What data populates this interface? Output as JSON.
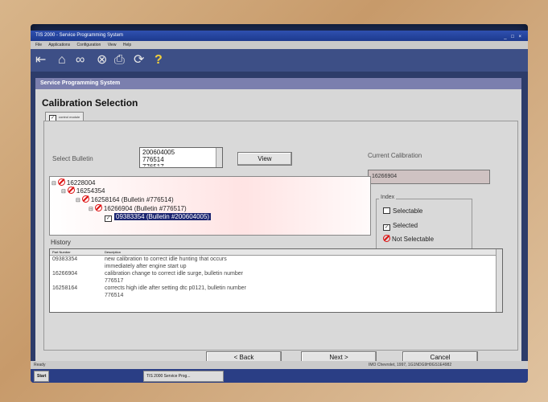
{
  "window": {
    "title": "TIS 2000 - Service Programming System",
    "controls": "_ □ ×"
  },
  "menu": [
    "File",
    "Applications",
    "Configuration",
    "View",
    "Help"
  ],
  "toolbar_icons": [
    "back-arrow-icon",
    "home-icon",
    "binoculars-icon",
    "stop-icon",
    "print-icon",
    "refresh-icon",
    "help-icon"
  ],
  "app": {
    "header": "Service Programming System",
    "title": "Calibration Selection",
    "tab": "control module"
  },
  "bulletin": {
    "label": "Select Bulletin",
    "options": [
      "200604005",
      "776514",
      "776517"
    ],
    "view_button": "View"
  },
  "current_calibration": {
    "label": "Current Calibration",
    "value": "16266904"
  },
  "tree": {
    "nodes": [
      {
        "text": "16228004",
        "level": 0,
        "icon": "not-selectable"
      },
      {
        "text": "16254354",
        "level": 1,
        "icon": "not-selectable"
      },
      {
        "text": "16258164   (Bulletin #776514)",
        "level": 2,
        "icon": "not-selectable"
      },
      {
        "text": "16266904   (Bulletin #776517)",
        "level": 3,
        "icon": "not-selectable"
      },
      {
        "text": "09383354   (Bulletin #200604005)",
        "level": 4,
        "icon": "selected"
      }
    ]
  },
  "legend": {
    "title": "Index",
    "selectable": "Selectable",
    "selected": "Selected",
    "not_selectable": "Not Selectable"
  },
  "history": {
    "label": "History",
    "columns": [
      "Part Number",
      "Description"
    ],
    "rows": [
      {
        "part": "09383354",
        "desc": "new calibration to correct idle hunting that occurs",
        "desc2": "immediately after engine start up"
      },
      {
        "part": "16266904",
        "desc": "calibration change to correct idle surge, bulletin number",
        "desc2": "776517"
      },
      {
        "part": "16258164",
        "desc": "corrects high idle after setting dtc p0121, bulletin number",
        "desc2": "776514"
      }
    ]
  },
  "buttons": {
    "back": "< Back",
    "next": "Next >",
    "cancel": "Cancel"
  },
  "statusbar": {
    "left": "Ready",
    "right": "IMO  Chevrolet, 1997, 1G1NDG9H0GS1E4982"
  },
  "taskbar": {
    "start": "Start",
    "task": "TIS 2000 Service Prog..."
  }
}
